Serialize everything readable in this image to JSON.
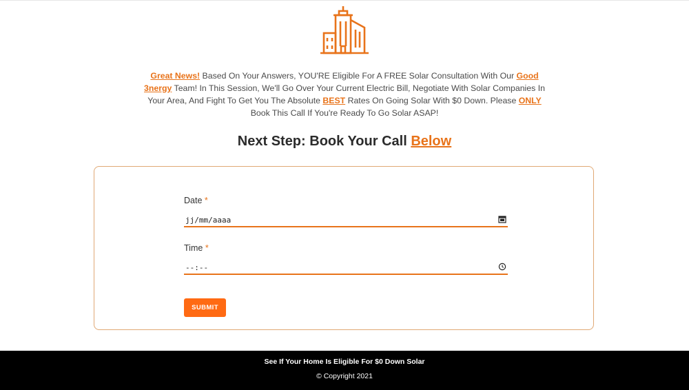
{
  "colors": {
    "accent": "#e8731a",
    "button": "#ff6a13",
    "footer_bg": "#000000",
    "card_border": "#e0a874"
  },
  "logo": {
    "icon": "building-icon"
  },
  "intro": {
    "great_news": "Great News!",
    "seg1": " Based On Your Answers, YOU'RE Eligible For A FREE Solar Consultation With Our ",
    "company": "Good 3nergy",
    "seg2": " Team! In This Session, We'll Go Over Your Current Electric Bill, Negotiate With Solar Companies In Your Area, And Fight To Get You The Absolute ",
    "best": "BEST",
    "seg3": " Rates On Going Solar With $0 Down. Please ",
    "only": "ONLY",
    "seg4": " Book This Call If You're Ready To Go Solar ASAP!"
  },
  "headline": {
    "text": "Next Step: Book Your Call ",
    "highlight": "Below"
  },
  "form": {
    "date_label": "Date",
    "date_value": "jj/mm/aaaa",
    "date_icon": "calendar-icon",
    "time_label": "Time",
    "time_value": "--:--",
    "time_icon": "clock-icon",
    "required_mark": "*",
    "submit_label": "SUBMIT"
  },
  "footer": {
    "tagline": "See If Your Home Is Eligible For $0 Down Solar",
    "copyright": "© Copyright 2021"
  }
}
